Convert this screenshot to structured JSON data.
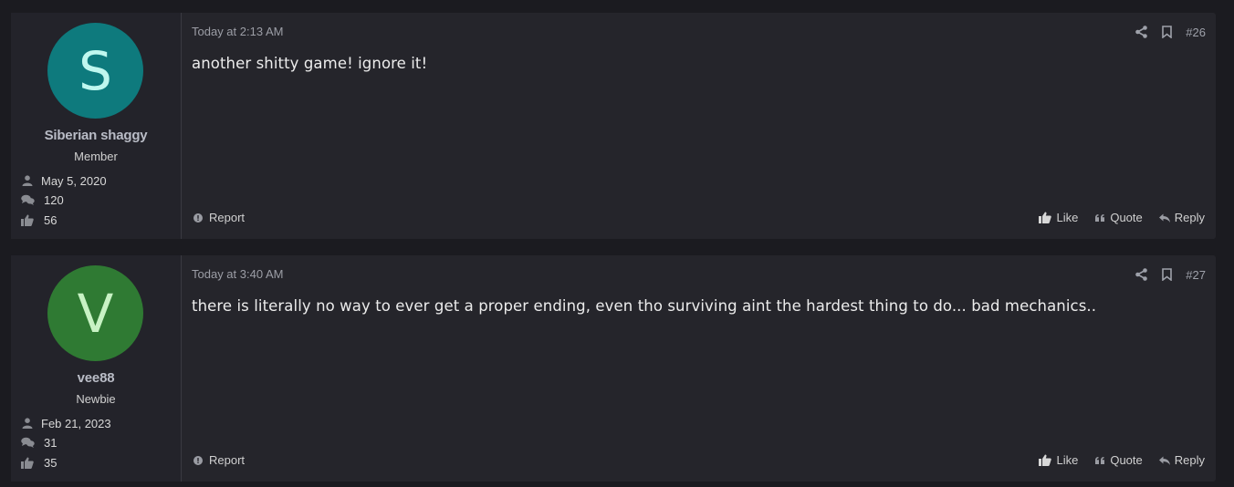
{
  "posts": [
    {
      "user": {
        "avatar_letter": "S",
        "avatar_color": "#0e7a7d",
        "avatar_letter_color": "#bff7ef",
        "name": "Siberian shaggy",
        "title": "Member",
        "joined": "May 5, 2020",
        "messages": "120",
        "reactions": "56"
      },
      "date": "Today at 2:13 AM",
      "post_number": "#26",
      "message": "another shitty game! ignore it!",
      "report_label": "Report",
      "like_label": "Like",
      "quote_label": "Quote",
      "reply_label": "Reply"
    },
    {
      "user": {
        "avatar_letter": "V",
        "avatar_color": "#2f7a33",
        "avatar_letter_color": "#c8f2c4",
        "name": "vee88",
        "title": "Newbie",
        "joined": "Feb 21, 2023",
        "messages": "31",
        "reactions": "35"
      },
      "date": "Today at 3:40 AM",
      "post_number": "#27",
      "message": "there is literally no way to ever get a proper ending, even tho surviving aint the hardest thing to do... bad mechanics..",
      "report_label": "Report",
      "like_label": "Like",
      "quote_label": "Quote",
      "reply_label": "Reply"
    }
  ],
  "icons": {
    "joined": "user-icon",
    "messages": "comments-icon",
    "reactions": "thumbs-up-icon",
    "share": "share-icon",
    "bookmark": "bookmark-icon",
    "report": "info-circle-icon",
    "like": "thumbs-up-icon",
    "quote": "quote-icon",
    "reply": "reply-icon"
  },
  "colors": {
    "background": "#1b1b20",
    "post_background": "#25252b",
    "username": "#b9bcc6"
  }
}
